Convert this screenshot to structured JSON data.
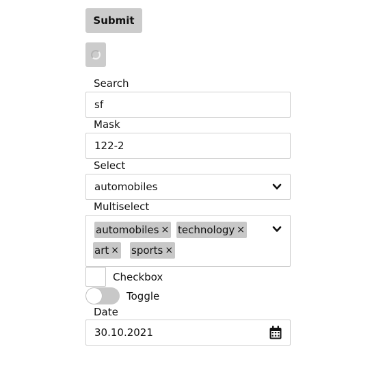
{
  "buttons": {
    "submit_label": "Submit"
  },
  "search": {
    "label": "Search",
    "value": "sf"
  },
  "mask": {
    "label": "Mask",
    "value": "122-2"
  },
  "select": {
    "label": "Select",
    "value": "automobiles"
  },
  "multiselect": {
    "label": "Multiselect",
    "tags": [
      {
        "label": "automobiles",
        "remove": "×"
      },
      {
        "label": "technology",
        "remove": "×"
      },
      {
        "label": "art",
        "remove": "×"
      },
      {
        "label": "sports",
        "remove": "×"
      }
    ]
  },
  "checkbox": {
    "label": "Checkbox",
    "checked": false
  },
  "toggle": {
    "label": "Toggle",
    "on": false
  },
  "date": {
    "label": "Date",
    "value": "30.10.2021"
  },
  "icons": {
    "loading": "spinner-icon",
    "dropdown": "chevron-down-icon",
    "calendar": "calendar-icon"
  }
}
